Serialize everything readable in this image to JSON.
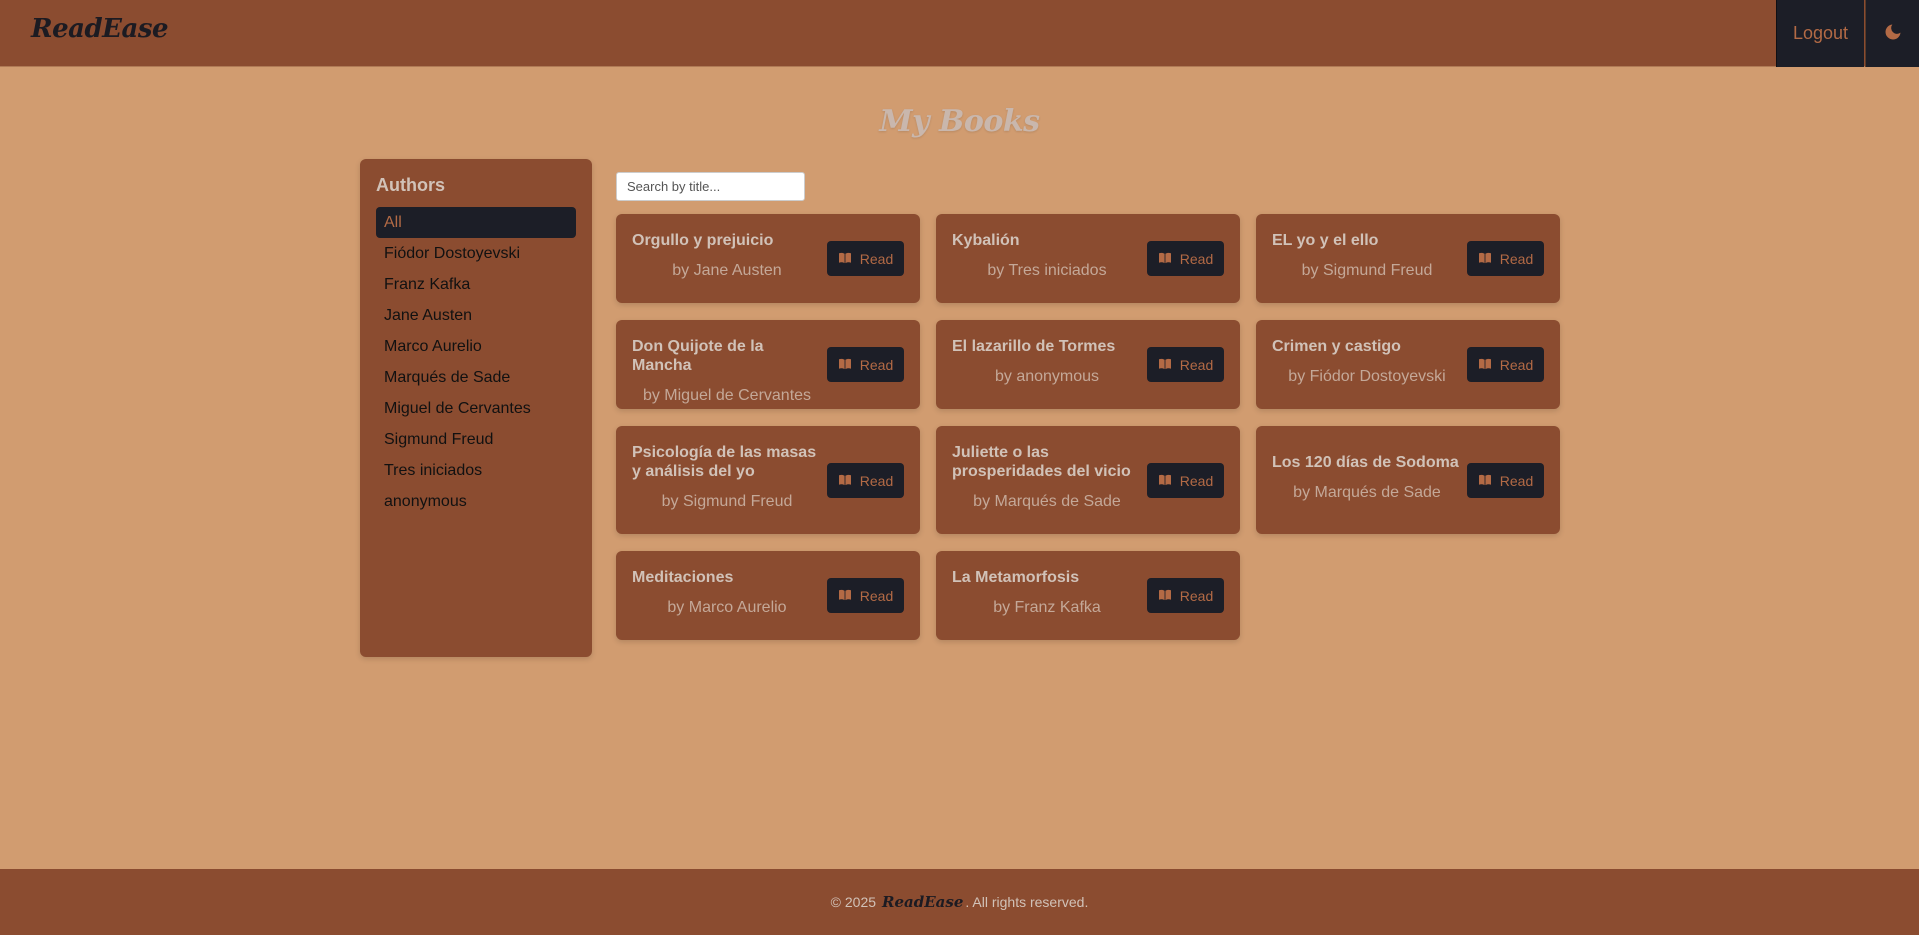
{
  "header": {
    "logo": "ReadEase",
    "logout_label": "Logout"
  },
  "page_title": "My Books",
  "sidebar": {
    "title": "Authors",
    "items": [
      {
        "label": "All",
        "active": true
      },
      {
        "label": "Fiódor Dostoyevski"
      },
      {
        "label": "Franz Kafka"
      },
      {
        "label": "Jane Austen"
      },
      {
        "label": "Marco Aurelio"
      },
      {
        "label": "Marqués de Sade"
      },
      {
        "label": "Miguel de Cervantes"
      },
      {
        "label": "Sigmund Freud"
      },
      {
        "label": "Tres iniciados"
      },
      {
        "label": "anonymous"
      }
    ]
  },
  "search": {
    "placeholder": "Search by title...",
    "value": ""
  },
  "read_label": "Read",
  "books": [
    {
      "title": "Orgullo y prejuicio",
      "author": "by Jane Austen"
    },
    {
      "title": "Kybalión",
      "author": "by Tres iniciados"
    },
    {
      "title": "EL yo y el ello",
      "author": "by Sigmund Freud"
    },
    {
      "title": "Don Quijote de la Mancha",
      "author": "by Miguel de Cervantes"
    },
    {
      "title": "El lazarillo de Tormes",
      "author": "by anonymous"
    },
    {
      "title": "Crimen y castigo",
      "author": "by Fiódor Dostoyevski"
    },
    {
      "title": "Psicología de las masas y análisis del yo",
      "author": "by Sigmund Freud"
    },
    {
      "title": "Juliette o las prosperidades del vicio",
      "author": "by Marqués de Sade"
    },
    {
      "title": "Los 120 días de Sodoma",
      "author": "by Marqués de Sade"
    },
    {
      "title": "Meditaciones",
      "author": "by Marco Aurelio"
    },
    {
      "title": "La Metamorfosis",
      "author": "by Franz Kafka"
    }
  ],
  "footer": {
    "prefix": "© 2025",
    "brand": "ReadEase",
    "suffix": ". All rights reserved."
  },
  "icons": {
    "theme": "moon-icon",
    "read": "book-open-icon"
  },
  "colors": {
    "header_bg": "#8b4c30",
    "page_bg": "#d19c70",
    "button_bg": "#1c1e27",
    "accent_text": "#b36a45"
  }
}
